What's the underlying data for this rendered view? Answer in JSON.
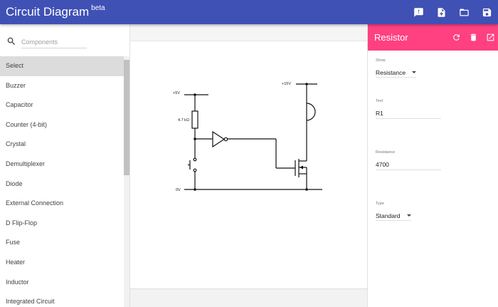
{
  "app": {
    "title": "Circuit Diagram",
    "badge": "beta",
    "actions": [
      {
        "name": "feedback-icon"
      },
      {
        "name": "new-file-icon"
      },
      {
        "name": "open-folder-icon"
      },
      {
        "name": "save-icon"
      }
    ]
  },
  "sidebar": {
    "search": {
      "placeholder": "Components",
      "value": ""
    },
    "items": [
      {
        "label": "Select",
        "selected": true
      },
      {
        "label": "Buzzer"
      },
      {
        "label": "Capacitor"
      },
      {
        "label": "Counter (4-bit)"
      },
      {
        "label": "Crystal"
      },
      {
        "label": "Demultiplexer"
      },
      {
        "label": "Diode"
      },
      {
        "label": "External Connection"
      },
      {
        "label": "D Flip-Flop"
      },
      {
        "label": "Fuse"
      },
      {
        "label": "Heater"
      },
      {
        "label": "Inductor"
      },
      {
        "label": "Integrated Circuit"
      }
    ]
  },
  "canvas": {
    "labels": {
      "v5": "+5V",
      "v15": "+15V",
      "resistor": "4.7 kΩ",
      "ground": "0V"
    }
  },
  "properties": {
    "title": "Resistor",
    "actions": [
      {
        "name": "rotate-icon"
      },
      {
        "name": "delete-icon"
      },
      {
        "name": "open-external-icon"
      }
    ],
    "show": {
      "label": "Show",
      "value": "Resistance"
    },
    "text": {
      "label": "Text",
      "value": "R1"
    },
    "resistance": {
      "label": "Resistance",
      "value": "4700"
    },
    "type": {
      "label": "Type",
      "value": "Standard"
    }
  },
  "colors": {
    "appbar": "#3f51b5",
    "accent": "#ff4081"
  }
}
